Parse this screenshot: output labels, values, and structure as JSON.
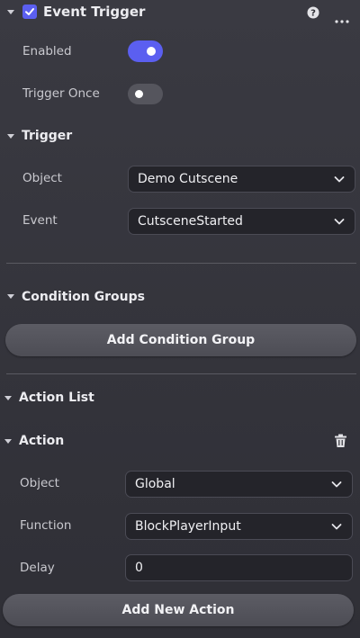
{
  "header": {
    "title": "Event Trigger",
    "checked": true
  },
  "toggles": {
    "enabled_label": "Enabled",
    "enabled_on": true,
    "trigger_once_label": "Trigger Once",
    "trigger_once_on": false
  },
  "trigger": {
    "title": "Trigger",
    "object_label": "Object",
    "object_value": "Demo Cutscene",
    "event_label": "Event",
    "event_value": "CutsceneStarted"
  },
  "conditions": {
    "title": "Condition Groups",
    "add_button": "Add Condition Group"
  },
  "actions": {
    "title": "Action List",
    "action_title": "Action",
    "object_label": "Object",
    "object_value": "Global",
    "function_label": "Function",
    "function_value": "BlockPlayerInput",
    "delay_label": "Delay",
    "delay_value": "0",
    "add_button": "Add New Action"
  },
  "colors": {
    "accent": "#5b5ff0",
    "toggle_off": "#55555d"
  },
  "icons": [
    "collapse-caret-icon",
    "checkbox-icon",
    "help-icon",
    "more-icon",
    "chevron-down-icon",
    "trash-icon"
  ]
}
